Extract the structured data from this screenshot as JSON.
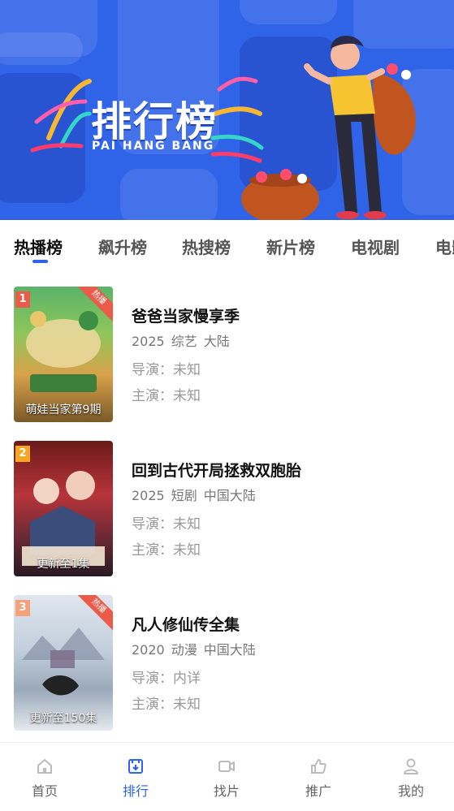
{
  "banner": {
    "title": "排行榜",
    "subtitle": "PAI HANG BANG"
  },
  "tabs": [
    {
      "label": "热播榜",
      "active": true
    },
    {
      "label": "飙升榜",
      "active": false
    },
    {
      "label": "热搜榜",
      "active": false
    },
    {
      "label": "新片榜",
      "active": false
    },
    {
      "label": "电视剧",
      "active": false
    },
    {
      "label": "电影",
      "active": false
    }
  ],
  "items": [
    {
      "rank": "1",
      "badge": "热播",
      "overlay": "萌娃当家第9期",
      "title": "爸爸当家慢享季",
      "year": "2025",
      "genre": "综艺",
      "region": "大陆",
      "director": "导演：未知",
      "actors": "主演：未知"
    },
    {
      "rank": "2",
      "badge": "",
      "overlay": "更新至1集",
      "title": "回到古代开局拯救双胞胎",
      "year": "2025",
      "genre": "短剧",
      "region": "中国大陆",
      "director": "导演：未知",
      "actors": "主演：未知"
    },
    {
      "rank": "3",
      "badge": "热播",
      "overlay": "更新至150集",
      "title": "凡人修仙传全集",
      "year": "2020",
      "genre": "动漫",
      "region": "中国大陆",
      "director": "导演：内详",
      "actors": "主演：未知"
    }
  ],
  "nav": [
    {
      "label": "首页",
      "icon": "home-icon"
    },
    {
      "label": "排行",
      "icon": "ranking-icon"
    },
    {
      "label": "找片",
      "icon": "video-icon"
    },
    {
      "label": "推广",
      "icon": "thumbs-up-icon"
    },
    {
      "label": "我的",
      "icon": "user-icon"
    }
  ],
  "colors": {
    "accent": "#2f63e8",
    "hot_badge": "#ec5b4a",
    "rank1": "#ec5b4a",
    "rank2": "#f5a623",
    "rank3": "#f5a17a"
  }
}
